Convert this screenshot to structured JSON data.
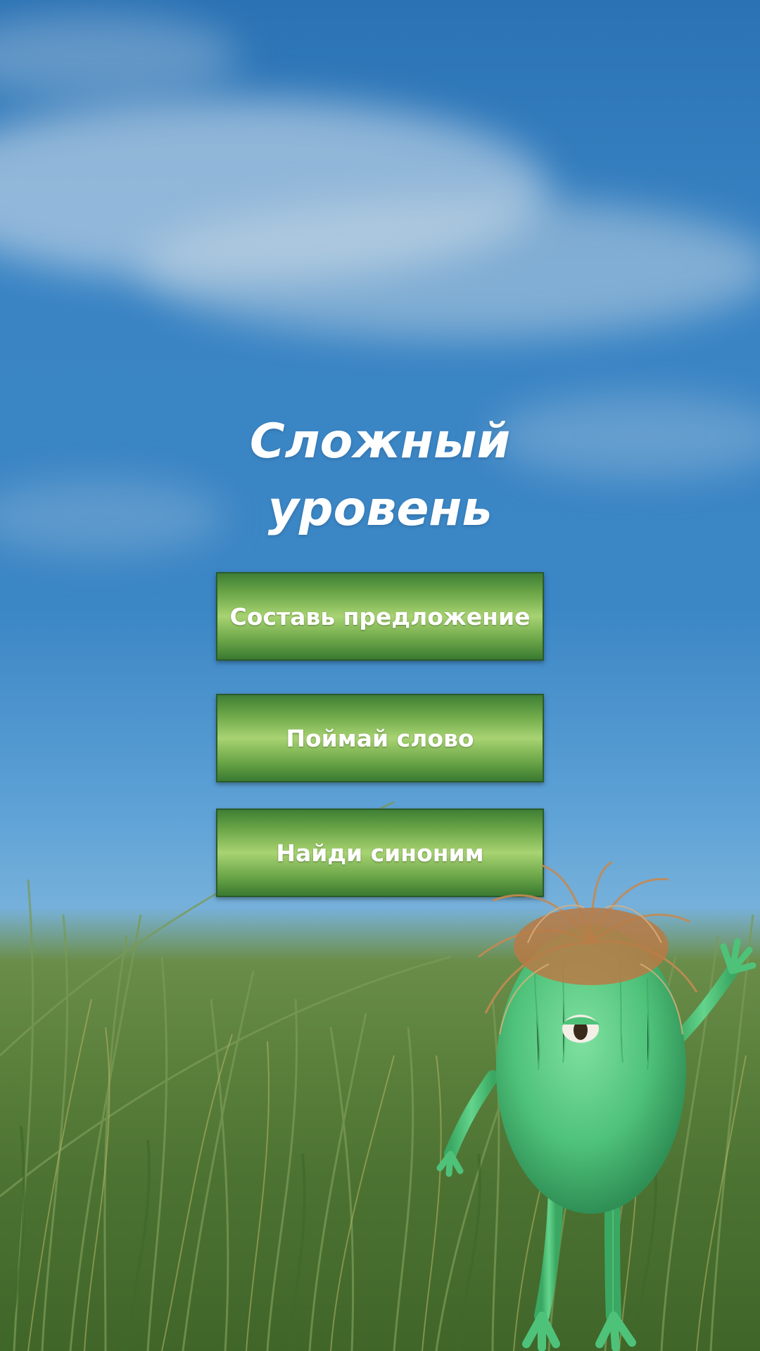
{
  "screen": {
    "title_line1": "Сложный",
    "title_line2": "уровень"
  },
  "menu": {
    "items": [
      {
        "label": "Составь предложение"
      },
      {
        "label": "Поймай слово"
      },
      {
        "label": "Найди синоним"
      }
    ]
  },
  "colors": {
    "sky": "#3b86c5",
    "button_green": "#6aa547",
    "button_border": "#2b5a2c",
    "grass": "#5b803c",
    "monster_body": "#4fc27a",
    "monster_hair": "#b87a45"
  },
  "icons": {
    "character": "green-monster-character"
  }
}
